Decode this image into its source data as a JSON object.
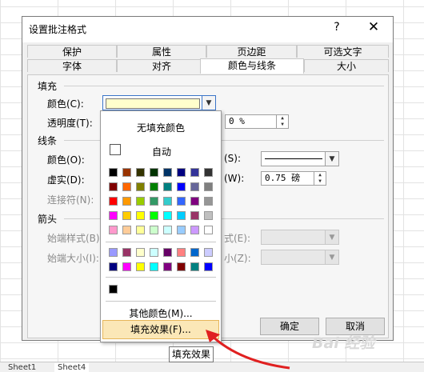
{
  "dialog": {
    "title": "设置批注格式",
    "help": "?",
    "close": "✕"
  },
  "tabs_back": [
    "保护",
    "属性",
    "页边距",
    "可选文字"
  ],
  "tabs_front": [
    "字体",
    "对齐",
    "颜色与线条",
    "大小"
  ],
  "active_tab": "颜色与线条",
  "fill": {
    "section": "填充",
    "color_label": "颜色(C):",
    "color_value": "#ffffcc",
    "transparency_label": "透明度(T):",
    "transparency_value": "0 %"
  },
  "line": {
    "section": "线条",
    "color_label": "颜色(O):",
    "dash_label": "虚实(D):",
    "connector_label": "连接符(N):",
    "style_suffix": "(S):",
    "weight_suffix": "(W):",
    "weight_value": "0.75 磅"
  },
  "arrows": {
    "section": "箭头",
    "begin_style_label": "始端样式(B):",
    "begin_size_label": "始端大小(I):",
    "end_style_suffix": "式(E):",
    "end_size_suffix": "小(Z):"
  },
  "buttons": {
    "ok": "确定",
    "cancel": "取消"
  },
  "palette_popup": {
    "no_fill": "无填充颜色",
    "automatic": "自动",
    "more_colors": "其他颜色(M)...",
    "fill_effects": "填充效果(F)...",
    "grid_colors": [
      [
        "#000000",
        "#993300",
        "#333300",
        "#003300",
        "#003366",
        "#000080",
        "#333399",
        "#333333"
      ],
      [
        "#800000",
        "#ff6600",
        "#808000",
        "#008000",
        "#008080",
        "#0000ff",
        "#666699",
        "#808080"
      ],
      [
        "#ff0000",
        "#ff9900",
        "#99cc00",
        "#339966",
        "#33cccc",
        "#3366ff",
        "#800080",
        "#969696"
      ],
      [
        "#ff00ff",
        "#ffcc00",
        "#ffff00",
        "#00ff00",
        "#00ffff",
        "#00ccff",
        "#993366",
        "#c0c0c0"
      ],
      [
        "#ff99cc",
        "#ffcc99",
        "#ffff99",
        "#ccffcc",
        "#ccffff",
        "#99ccff",
        "#cc99ff",
        "#ffffff"
      ]
    ],
    "extra_colors": [
      [
        "#9999ff",
        "#993366",
        "#ffffcc",
        "#ccffff",
        "#660066",
        "#ff8080",
        "#0066cc",
        "#ccccff"
      ],
      [
        "#000080",
        "#ff00ff",
        "#ffff00",
        "#00ffff",
        "#800080",
        "#800000",
        "#008080",
        "#0000ff"
      ]
    ],
    "recent_colors": [
      "#000000"
    ]
  },
  "tooltip": "填充效果",
  "sheet_tabs": [
    "Sheet1",
    "Sheet4"
  ],
  "watermark": "Bai 经验"
}
